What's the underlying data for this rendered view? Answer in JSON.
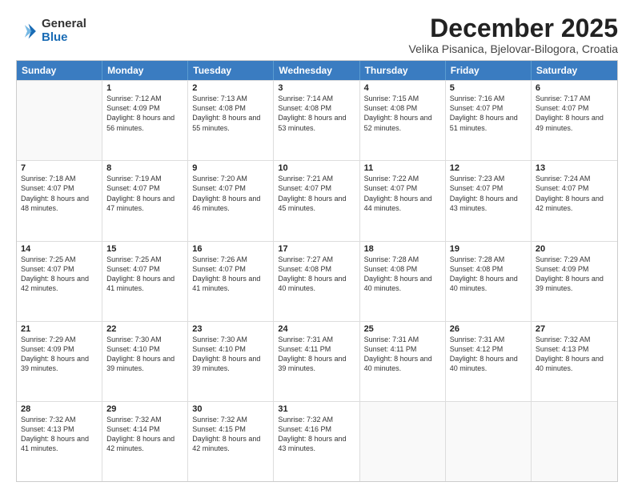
{
  "logo": {
    "general": "General",
    "blue": "Blue"
  },
  "header": {
    "month": "December 2025",
    "location": "Velika Pisanica, Bjelovar-Bilogora, Croatia"
  },
  "weekdays": [
    "Sunday",
    "Monday",
    "Tuesday",
    "Wednesday",
    "Thursday",
    "Friday",
    "Saturday"
  ],
  "weeks": [
    [
      {
        "day": "",
        "sunrise": "",
        "sunset": "",
        "daylight": ""
      },
      {
        "day": "1",
        "sunrise": "Sunrise: 7:12 AM",
        "sunset": "Sunset: 4:09 PM",
        "daylight": "Daylight: 8 hours and 56 minutes."
      },
      {
        "day": "2",
        "sunrise": "Sunrise: 7:13 AM",
        "sunset": "Sunset: 4:08 PM",
        "daylight": "Daylight: 8 hours and 55 minutes."
      },
      {
        "day": "3",
        "sunrise": "Sunrise: 7:14 AM",
        "sunset": "Sunset: 4:08 PM",
        "daylight": "Daylight: 8 hours and 53 minutes."
      },
      {
        "day": "4",
        "sunrise": "Sunrise: 7:15 AM",
        "sunset": "Sunset: 4:08 PM",
        "daylight": "Daylight: 8 hours and 52 minutes."
      },
      {
        "day": "5",
        "sunrise": "Sunrise: 7:16 AM",
        "sunset": "Sunset: 4:07 PM",
        "daylight": "Daylight: 8 hours and 51 minutes."
      },
      {
        "day": "6",
        "sunrise": "Sunrise: 7:17 AM",
        "sunset": "Sunset: 4:07 PM",
        "daylight": "Daylight: 8 hours and 49 minutes."
      }
    ],
    [
      {
        "day": "7",
        "sunrise": "Sunrise: 7:18 AM",
        "sunset": "Sunset: 4:07 PM",
        "daylight": "Daylight: 8 hours and 48 minutes."
      },
      {
        "day": "8",
        "sunrise": "Sunrise: 7:19 AM",
        "sunset": "Sunset: 4:07 PM",
        "daylight": "Daylight: 8 hours and 47 minutes."
      },
      {
        "day": "9",
        "sunrise": "Sunrise: 7:20 AM",
        "sunset": "Sunset: 4:07 PM",
        "daylight": "Daylight: 8 hours and 46 minutes."
      },
      {
        "day": "10",
        "sunrise": "Sunrise: 7:21 AM",
        "sunset": "Sunset: 4:07 PM",
        "daylight": "Daylight: 8 hours and 45 minutes."
      },
      {
        "day": "11",
        "sunrise": "Sunrise: 7:22 AM",
        "sunset": "Sunset: 4:07 PM",
        "daylight": "Daylight: 8 hours and 44 minutes."
      },
      {
        "day": "12",
        "sunrise": "Sunrise: 7:23 AM",
        "sunset": "Sunset: 4:07 PM",
        "daylight": "Daylight: 8 hours and 43 minutes."
      },
      {
        "day": "13",
        "sunrise": "Sunrise: 7:24 AM",
        "sunset": "Sunset: 4:07 PM",
        "daylight": "Daylight: 8 hours and 42 minutes."
      }
    ],
    [
      {
        "day": "14",
        "sunrise": "Sunrise: 7:25 AM",
        "sunset": "Sunset: 4:07 PM",
        "daylight": "Daylight: 8 hours and 42 minutes."
      },
      {
        "day": "15",
        "sunrise": "Sunrise: 7:25 AM",
        "sunset": "Sunset: 4:07 PM",
        "daylight": "Daylight: 8 hours and 41 minutes."
      },
      {
        "day": "16",
        "sunrise": "Sunrise: 7:26 AM",
        "sunset": "Sunset: 4:07 PM",
        "daylight": "Daylight: 8 hours and 41 minutes."
      },
      {
        "day": "17",
        "sunrise": "Sunrise: 7:27 AM",
        "sunset": "Sunset: 4:08 PM",
        "daylight": "Daylight: 8 hours and 40 minutes."
      },
      {
        "day": "18",
        "sunrise": "Sunrise: 7:28 AM",
        "sunset": "Sunset: 4:08 PM",
        "daylight": "Daylight: 8 hours and 40 minutes."
      },
      {
        "day": "19",
        "sunrise": "Sunrise: 7:28 AM",
        "sunset": "Sunset: 4:08 PM",
        "daylight": "Daylight: 8 hours and 40 minutes."
      },
      {
        "day": "20",
        "sunrise": "Sunrise: 7:29 AM",
        "sunset": "Sunset: 4:09 PM",
        "daylight": "Daylight: 8 hours and 39 minutes."
      }
    ],
    [
      {
        "day": "21",
        "sunrise": "Sunrise: 7:29 AM",
        "sunset": "Sunset: 4:09 PM",
        "daylight": "Daylight: 8 hours and 39 minutes."
      },
      {
        "day": "22",
        "sunrise": "Sunrise: 7:30 AM",
        "sunset": "Sunset: 4:10 PM",
        "daylight": "Daylight: 8 hours and 39 minutes."
      },
      {
        "day": "23",
        "sunrise": "Sunrise: 7:30 AM",
        "sunset": "Sunset: 4:10 PM",
        "daylight": "Daylight: 8 hours and 39 minutes."
      },
      {
        "day": "24",
        "sunrise": "Sunrise: 7:31 AM",
        "sunset": "Sunset: 4:11 PM",
        "daylight": "Daylight: 8 hours and 39 minutes."
      },
      {
        "day": "25",
        "sunrise": "Sunrise: 7:31 AM",
        "sunset": "Sunset: 4:11 PM",
        "daylight": "Daylight: 8 hours and 40 minutes."
      },
      {
        "day": "26",
        "sunrise": "Sunrise: 7:31 AM",
        "sunset": "Sunset: 4:12 PM",
        "daylight": "Daylight: 8 hours and 40 minutes."
      },
      {
        "day": "27",
        "sunrise": "Sunrise: 7:32 AM",
        "sunset": "Sunset: 4:13 PM",
        "daylight": "Daylight: 8 hours and 40 minutes."
      }
    ],
    [
      {
        "day": "28",
        "sunrise": "Sunrise: 7:32 AM",
        "sunset": "Sunset: 4:13 PM",
        "daylight": "Daylight: 8 hours and 41 minutes."
      },
      {
        "day": "29",
        "sunrise": "Sunrise: 7:32 AM",
        "sunset": "Sunset: 4:14 PM",
        "daylight": "Daylight: 8 hours and 42 minutes."
      },
      {
        "day": "30",
        "sunrise": "Sunrise: 7:32 AM",
        "sunset": "Sunset: 4:15 PM",
        "daylight": "Daylight: 8 hours and 42 minutes."
      },
      {
        "day": "31",
        "sunrise": "Sunrise: 7:32 AM",
        "sunset": "Sunset: 4:16 PM",
        "daylight": "Daylight: 8 hours and 43 minutes."
      },
      {
        "day": "",
        "sunrise": "",
        "sunset": "",
        "daylight": ""
      },
      {
        "day": "",
        "sunrise": "",
        "sunset": "",
        "daylight": ""
      },
      {
        "day": "",
        "sunrise": "",
        "sunset": "",
        "daylight": ""
      }
    ]
  ]
}
